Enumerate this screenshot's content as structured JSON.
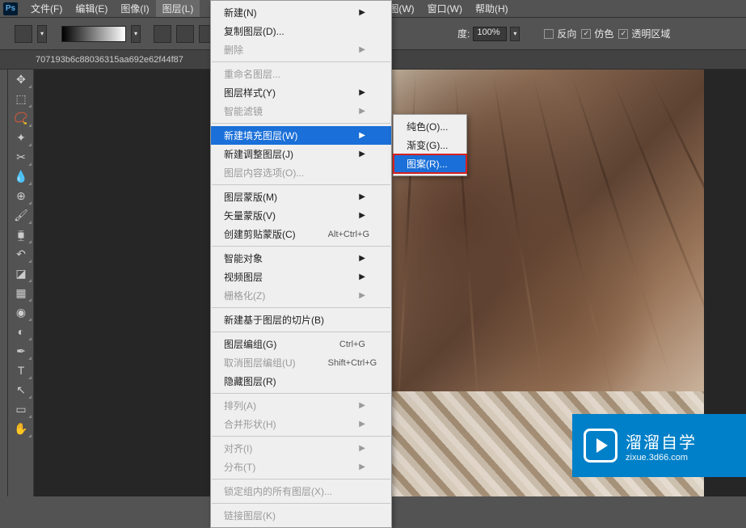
{
  "menubar": {
    "items": [
      "文件(F)",
      "编辑(E)",
      "图像(I)",
      "图层(L)",
      "图(W)",
      "窗口(W)",
      "帮助(H)"
    ]
  },
  "options": {
    "opacity_label": "度:",
    "opacity_value": "100%",
    "cb_reverse": "反向",
    "cb_dither": "仿色",
    "cb_transparent": "透明区域"
  },
  "doc_tab": "707193b6c88036315aa692e62f44f87",
  "layer_menu": [
    {
      "label": "新建(N)",
      "arrow": true
    },
    {
      "label": "复制图层(D)..."
    },
    {
      "label": "删除",
      "arrow": true,
      "disabled": true
    },
    {
      "sep": true
    },
    {
      "label": "重命名图层...",
      "disabled": true
    },
    {
      "label": "图层样式(Y)",
      "arrow": true
    },
    {
      "label": "智能滤镜",
      "arrow": true,
      "disabled": true
    },
    {
      "sep": true
    },
    {
      "label": "新建填充图层(W)",
      "arrow": true,
      "highlighted": true
    },
    {
      "label": "新建调整图层(J)",
      "arrow": true
    },
    {
      "label": "图层内容选项(O)...",
      "disabled": true
    },
    {
      "sep": true
    },
    {
      "label": "图层蒙版(M)",
      "arrow": true
    },
    {
      "label": "矢量蒙版(V)",
      "arrow": true
    },
    {
      "label": "创建剪贴蒙版(C)",
      "shortcut": "Alt+Ctrl+G"
    },
    {
      "sep": true
    },
    {
      "label": "智能对象",
      "arrow": true
    },
    {
      "label": "视频图层",
      "arrow": true
    },
    {
      "label": "栅格化(Z)",
      "arrow": true,
      "disabled": true
    },
    {
      "sep": true
    },
    {
      "label": "新建基于图层的切片(B)"
    },
    {
      "sep": true
    },
    {
      "label": "图层编组(G)",
      "shortcut": "Ctrl+G"
    },
    {
      "label": "取消图层编组(U)",
      "shortcut": "Shift+Ctrl+G",
      "disabled": true
    },
    {
      "label": "隐藏图层(R)"
    },
    {
      "sep": true
    },
    {
      "label": "排列(A)",
      "arrow": true,
      "disabled": true
    },
    {
      "label": "合并形状(H)",
      "arrow": true,
      "disabled": true
    },
    {
      "sep": true
    },
    {
      "label": "对齐(I)",
      "arrow": true,
      "disabled": true
    },
    {
      "label": "分布(T)",
      "arrow": true,
      "disabled": true
    },
    {
      "sep": true
    },
    {
      "label": "锁定组内的所有图层(X)...",
      "disabled": true
    },
    {
      "sep": true
    },
    {
      "label": "链接图层(K)",
      "disabled": true
    }
  ],
  "submenu": [
    {
      "label": "纯色(O)..."
    },
    {
      "label": "渐变(G)..."
    },
    {
      "label": "图案(R)...",
      "highlighted": true,
      "boxed": true
    }
  ],
  "watermark": {
    "title": "溜溜自学",
    "url": "zixue.3d66.com"
  }
}
